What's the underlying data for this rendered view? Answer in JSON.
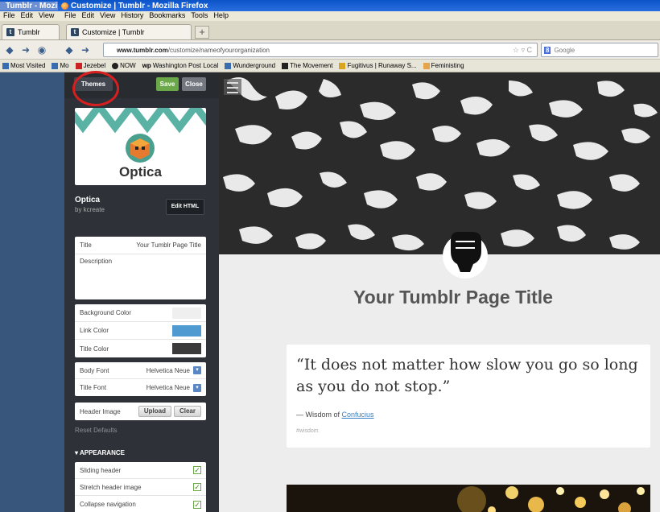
{
  "window": {
    "tab1_title": "Tumblr - Mozi",
    "tab2_title": "Customize | Tumblr - Mozilla Firefox"
  },
  "menus": {
    "left": [
      "File",
      "Edit",
      "View"
    ],
    "right": [
      "File",
      "Edit",
      "View",
      "History",
      "Bookmarks",
      "Tools",
      "Help"
    ]
  },
  "tabs": [
    {
      "label": "Tumblr"
    },
    {
      "label": "Customize | Tumblr"
    }
  ],
  "new_tab_label": "+",
  "nav": {
    "url_host": "www.tumblr.com",
    "url_path": "/customize/nameofyourorganization",
    "search_engine": "8",
    "search_placeholder": "Google"
  },
  "bookmarks": [
    "Most Visited",
    "Mo",
    "Jezebel",
    "NOW",
    "Washington Post Local",
    "Wunderground",
    "The Movement",
    "Fugitivus | Runaway S...",
    "Feministing"
  ],
  "panel": {
    "themes_label": "Themes",
    "save_label": "Save",
    "close_label": "Close",
    "theme_name": "Optica",
    "theme_name_big": "Optica",
    "theme_author": "by kcreate",
    "edit_html_label": "Edit HTML",
    "title_label": "Title",
    "title_value": "Your Tumblr Page Title",
    "description_label": "Description",
    "colors": [
      {
        "label": "Background Color",
        "color": "#efefef"
      },
      {
        "label": "Link Color",
        "color": "#4e9ad1"
      },
      {
        "label": "Title Color",
        "color": "#3a3a3a"
      }
    ],
    "fonts": [
      {
        "label": "Body Font",
        "value": "Helvetica Neue"
      },
      {
        "label": "Title Font",
        "value": "Helvetica Neue"
      }
    ],
    "header_image_label": "Header Image",
    "upload_label": "Upload",
    "clear_label": "Clear",
    "reset_label": "Reset Defaults",
    "appearance_label": "APPEARANCE",
    "options": [
      {
        "label": "Sliding header",
        "checked": true
      },
      {
        "label": "Stretch header image",
        "checked": true
      },
      {
        "label": "Collapse navigation",
        "checked": true
      }
    ]
  },
  "preview": {
    "page_title": "Your Tumblr Page Title",
    "quote": "“It does not matter how slow you go so long as you do not stop.”",
    "quote_prefix": "— Wisdom of",
    "quote_author": "Confucius",
    "tag": "#wisdom"
  }
}
